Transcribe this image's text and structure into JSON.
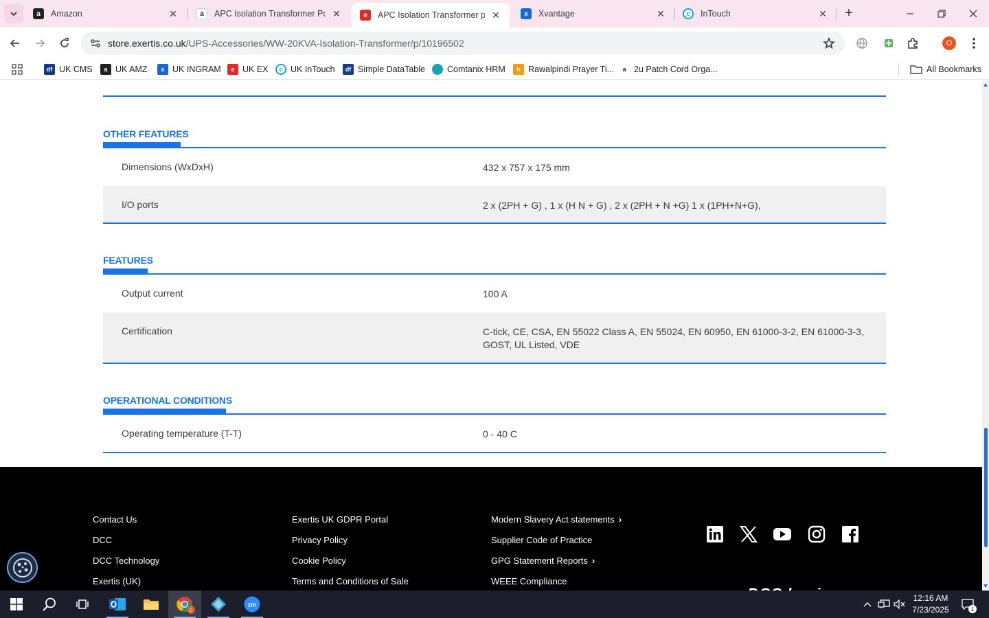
{
  "browser": {
    "tabs": [
      {
        "title": "Amazon",
        "favicon": "amazon-icon",
        "active": false
      },
      {
        "title": "APC Isolation Transformer Pow",
        "favicon": "amazon-icon",
        "active": false
      },
      {
        "title": "APC Isolation Transformer pow",
        "favicon": "exertis-icon",
        "active": true
      },
      {
        "title": "Xvantage",
        "favicon": "xvantage-icon",
        "active": false
      },
      {
        "title": "InTouch",
        "favicon": "intouch-icon",
        "active": false
      }
    ],
    "url_host": "store.exertis.co.uk",
    "url_path": "/UPS-Accessories/WW-20KVA-Isolation-Transformer/p/10196502",
    "profile_initial": "O",
    "bookmarks": [
      {
        "label": "UK CMS",
        "icon": "df-icon"
      },
      {
        "label": "UK AMZ",
        "icon": "amazon-icon"
      },
      {
        "label": "UK INGRAM",
        "icon": "xvantage-icon"
      },
      {
        "label": "UK EX",
        "icon": "exertis-icon"
      },
      {
        "label": "UK InTouch",
        "icon": "intouch-icon"
      },
      {
        "label": "Simple DataTable",
        "icon": "df-icon"
      },
      {
        "label": "Comtanix HRM",
        "icon": "comtanix-icon"
      },
      {
        "label": "Rawalpindi Prayer Ti...",
        "icon": "prayer-icon"
      },
      {
        "label": "2u Patch Cord Orga...",
        "icon": "amazon-icon"
      }
    ],
    "all_bookmarks_label": "All Bookmarks"
  },
  "specs": {
    "other_features": {
      "title": "OTHER FEATURES",
      "rows": [
        {
          "key": "Dimensions (WxDxH)",
          "value": "432 x 757 x 175 mm"
        },
        {
          "key": "I/O ports",
          "value": "2 x (2PH + G) , 1 x (H N + G) , 2 x (2PH + N +G) 1 x (1PH+N+G),"
        }
      ]
    },
    "features": {
      "title": "FEATURES",
      "rows": [
        {
          "key": "Output current",
          "value": "100 A"
        },
        {
          "key": "Certification",
          "value": "C-tick, CE, CSA, EN 55022 Class A, EN 55024, EN 60950, EN 61000-3-2, EN 61000-3-3, GOST, UL Listed, VDE"
        }
      ]
    },
    "operational_conditions": {
      "title": "OPERATIONAL CONDITIONS",
      "rows": [
        {
          "key": "Operating temperature (T-T)",
          "value": "0 - 40 C"
        }
      ]
    }
  },
  "footer": {
    "col1": [
      "Contact Us",
      "DCC",
      "DCC Technology",
      "Exertis (UK)"
    ],
    "col2": [
      "Exertis UK GDPR Portal",
      "Privacy Policy",
      "Cookie Policy",
      "Terms and Conditions of Sale"
    ],
    "col3": [
      "Modern Slavery Act statements",
      "Supplier Code of Practice",
      "GPG Statement Reports",
      "WEEE Compliance"
    ],
    "social": [
      "linkedin-icon",
      "x-icon",
      "youtube-icon",
      "instagram-icon",
      "facebook-icon"
    ],
    "brand_text": "a DCC business"
  },
  "taskbar": {
    "time": "12:16 AM",
    "date": "7/23/2025",
    "chrome_badge": "0",
    "notification_count": "1"
  },
  "colors": {
    "accent": "#1a73e8",
    "tabstrip": "#f9e5ef",
    "footer_bg": "#000000",
    "taskbar_bg": "#1c1f2b"
  }
}
